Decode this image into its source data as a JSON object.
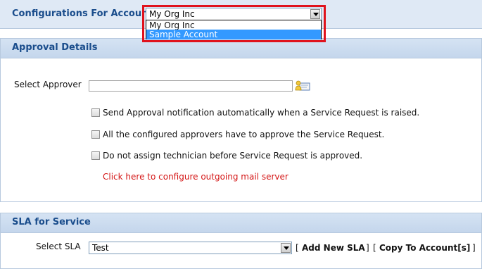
{
  "header": {
    "title": "Configurations For Account",
    "account_select_value": "My Org Inc",
    "account_options": [
      "My Org Inc",
      "Sample Account"
    ],
    "selected_option_index": 1
  },
  "approval": {
    "title": "Approval Details",
    "select_approver_label": "Select Approver",
    "approver_value": "",
    "checkboxes": [
      {
        "label": "Send Approval notification automatically when a Service Request is raised.",
        "checked": false
      },
      {
        "label": "All the configured approvers have to approve the Service Request.",
        "checked": false
      },
      {
        "label": "Do not assign technician before Service Request is approved.",
        "checked": false
      }
    ],
    "mail_link": "Click here to configure outgoing mail server"
  },
  "sla": {
    "title": "SLA for Service",
    "select_sla_label": "Select SLA",
    "sla_value": "Test",
    "add_new_sla": "Add New SLA",
    "copy_to_account": "Copy To Account[s]",
    "bracket_open": "[",
    "bracket_close": "]"
  },
  "colors": {
    "highlight": "#e0131d",
    "panel_title": "#1a4d8c",
    "link_red": "#d41515",
    "selected_option": "#3399ff"
  }
}
